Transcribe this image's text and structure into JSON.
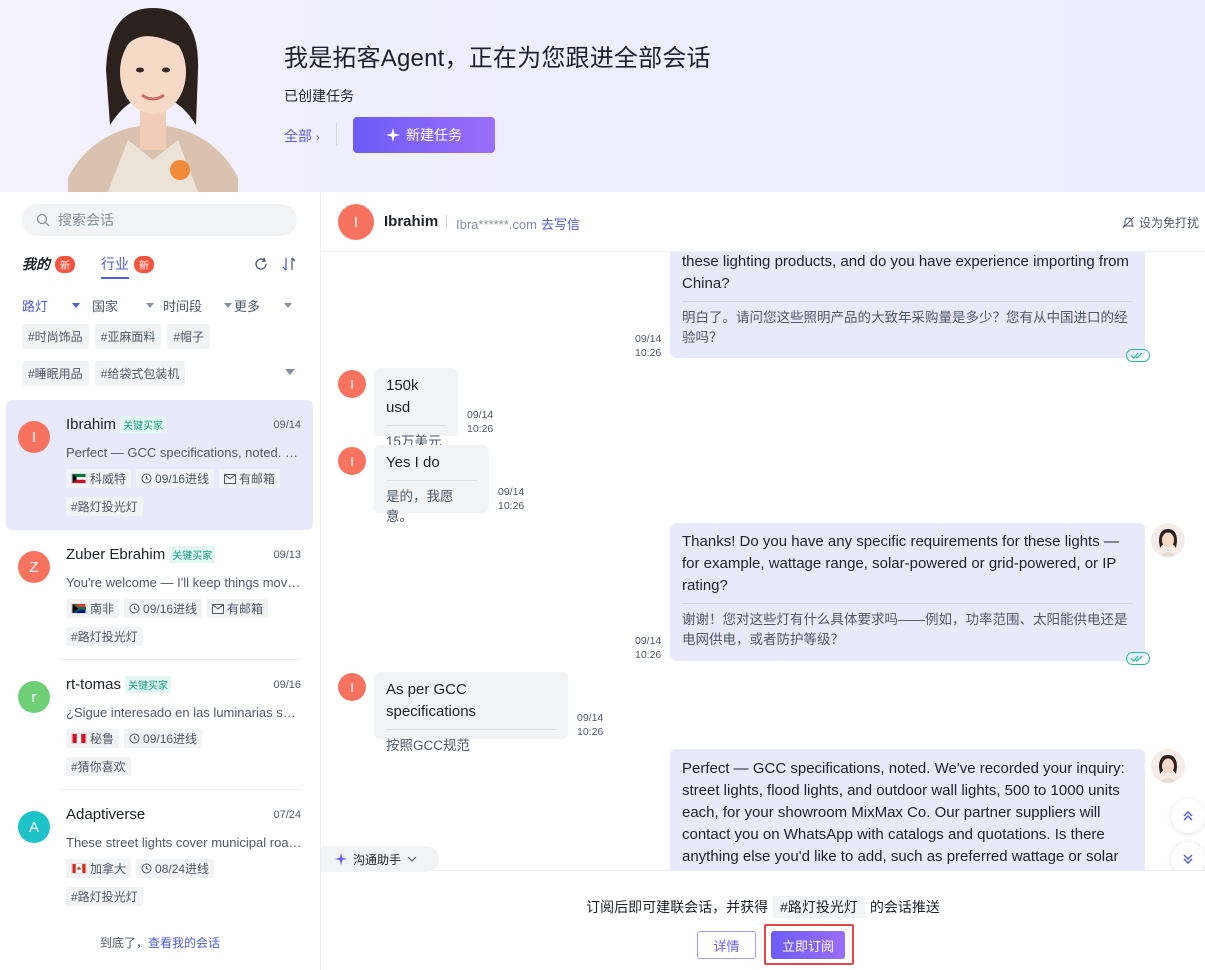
{
  "hero": {
    "title": "我是拓客Agent，正在为您跟进全部会话",
    "subtitle": "已创建任务",
    "all_link": "全部",
    "all_chevron": "›",
    "new_task_label": "新建任务"
  },
  "sidebar": {
    "search_placeholder": "搜索会话",
    "tabs": [
      {
        "label": "我的",
        "badge": "新"
      },
      {
        "label": "行业",
        "badge": "新"
      }
    ],
    "filters": [
      "路灯",
      "国家",
      "时间段",
      "更多"
    ],
    "chips": [
      "#时尚饰品",
      "#亚麻面料",
      "#帽子",
      "#睡眠用品",
      "#给袋式包装机"
    ],
    "conversations": [
      {
        "initial": "I",
        "color": "#f8735f",
        "name": "Ibrahim",
        "badge": "关键买家",
        "date": "09/14",
        "preview": "Perfect — GCC specifications, noted. We've recorded your inquiry",
        "country": "科威特",
        "followup": "09/16进线",
        "mailbox": "有邮箱",
        "tag": "#路灯投光灯"
      },
      {
        "initial": "Z",
        "color": "#f8735f",
        "name": "Zuber Ebrahim",
        "badge": "关键买家",
        "date": "09/13",
        "preview": "You're welcome — I'll keep things moving for you",
        "country": "南非",
        "followup": "09/16进线",
        "mailbox": "有邮箱",
        "tag": "#路灯投光灯"
      },
      {
        "initial": "r",
        "color": "#6fcf76",
        "name": "rt-tomas",
        "badge": "关键买家",
        "date": "09/16",
        "preview": "¿Sigue interesado en las luminarias solares?",
        "country": "秘鲁",
        "followup": "09/16进线",
        "mailbox": "",
        "tag": "#猜你喜欢"
      },
      {
        "initial": "A",
        "color": "#1ec3c8",
        "name": "Adaptiverse",
        "badge": "",
        "date": "07/24",
        "preview": "These street lights cover municipal roads and parks",
        "country": "加拿大",
        "followup": "08/24进线",
        "mailbox": "",
        "tag": "#路灯投光灯"
      }
    ],
    "end_text": "到底了，",
    "end_link": "查看我的会话"
  },
  "chat": {
    "contact_initial": "I",
    "contact_name": "Ibrahim",
    "contact_email": "Ibra******.com",
    "write_link": "去写信",
    "dnd_label": "设为免打扰",
    "messages": [
      {
        "dir": "out",
        "text": "these lighting products, and do you have experience importing from China?",
        "translation": "明白了。请问您这些照明产品的大致年采购量是多少？您有从中国进口的经验吗？",
        "date": "09/14",
        "time": "10:26"
      },
      {
        "dir": "in",
        "text": "150k usd",
        "translation": "15万美元",
        "date": "09/14",
        "time": "10:26"
      },
      {
        "dir": "in",
        "text": "Yes I do",
        "translation": "是的，我愿意。",
        "date": "09/14",
        "time": "10:26"
      },
      {
        "dir": "out",
        "text": "Thanks! Do you have any specific requirements for these lights — for example, wattage range, solar-powered or grid-powered, or IP rating?",
        "translation": "谢谢！您对这些灯有什么具体要求吗——例如，功率范围、太阳能供电还是电网供电，或者防护等级？",
        "date": "09/14",
        "time": "10:26"
      },
      {
        "dir": "in",
        "text": "As per GCC specifications",
        "translation": "按照GCC规范",
        "date": "09/14",
        "time": "10:26"
      },
      {
        "dir": "out",
        "text": "Perfect — GCC specifications, noted. We've recorded your inquiry: street lights, flood lights, and outdoor wall lights, 500 to 1000 units each, for your showroom MixMax Co. Our partner suppliers will contact you on WhatsApp with catalogs and quotations. Is there anything else you'd like to add, such as preferred wattage or solar",
        "translation": "",
        "date": "",
        "time": ""
      }
    ],
    "assistant_label": "沟通助手",
    "footer_text_before": "订阅后即可建联会话，并获得",
    "footer_tag": "#路灯投光灯",
    "footer_text_after": "的会话推送",
    "detail_label": "详情",
    "subscribe_label": "立即订阅"
  }
}
